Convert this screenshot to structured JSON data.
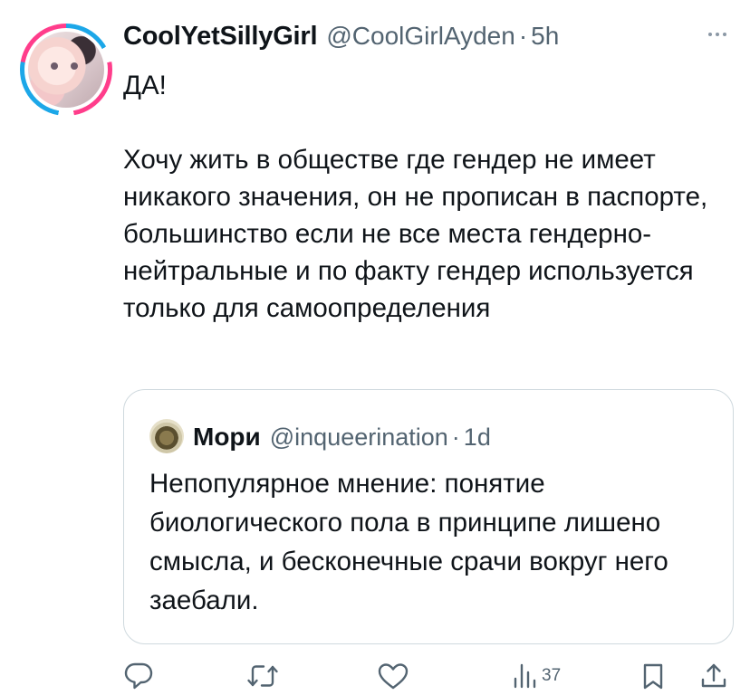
{
  "tweet": {
    "display_name": "CoolYetSillyGirl",
    "handle": "@CoolGirlAyden",
    "separator": "·",
    "time": "5h",
    "text": "ДА!\n\nХочу жить в обществе где гендер не имеет никакого значения, он не прописан в паспорте, большинство если не все места гендерно-нейтральные и по факту гендер используется только для самоопределения"
  },
  "quote": {
    "display_name": "Мори",
    "handle": "@inqueerination",
    "separator": "·",
    "time": "1d",
    "text": "Непопулярное мнение: понятие биологического пола в принципе лишено смысла, и бесконечные срачи вокруг него заебали."
  },
  "actions": {
    "views_count": "37",
    "icons": [
      "reply-icon",
      "retweet-icon",
      "like-icon",
      "views-icon",
      "bookmark-icon",
      "share-icon"
    ]
  },
  "colors": {
    "text_primary": "#0f1419",
    "text_secondary": "#536471",
    "border": "#cfd9de",
    "avatar_ring_pink": "#ff3d8b",
    "avatar_ring_blue": "#1ca7e8"
  }
}
